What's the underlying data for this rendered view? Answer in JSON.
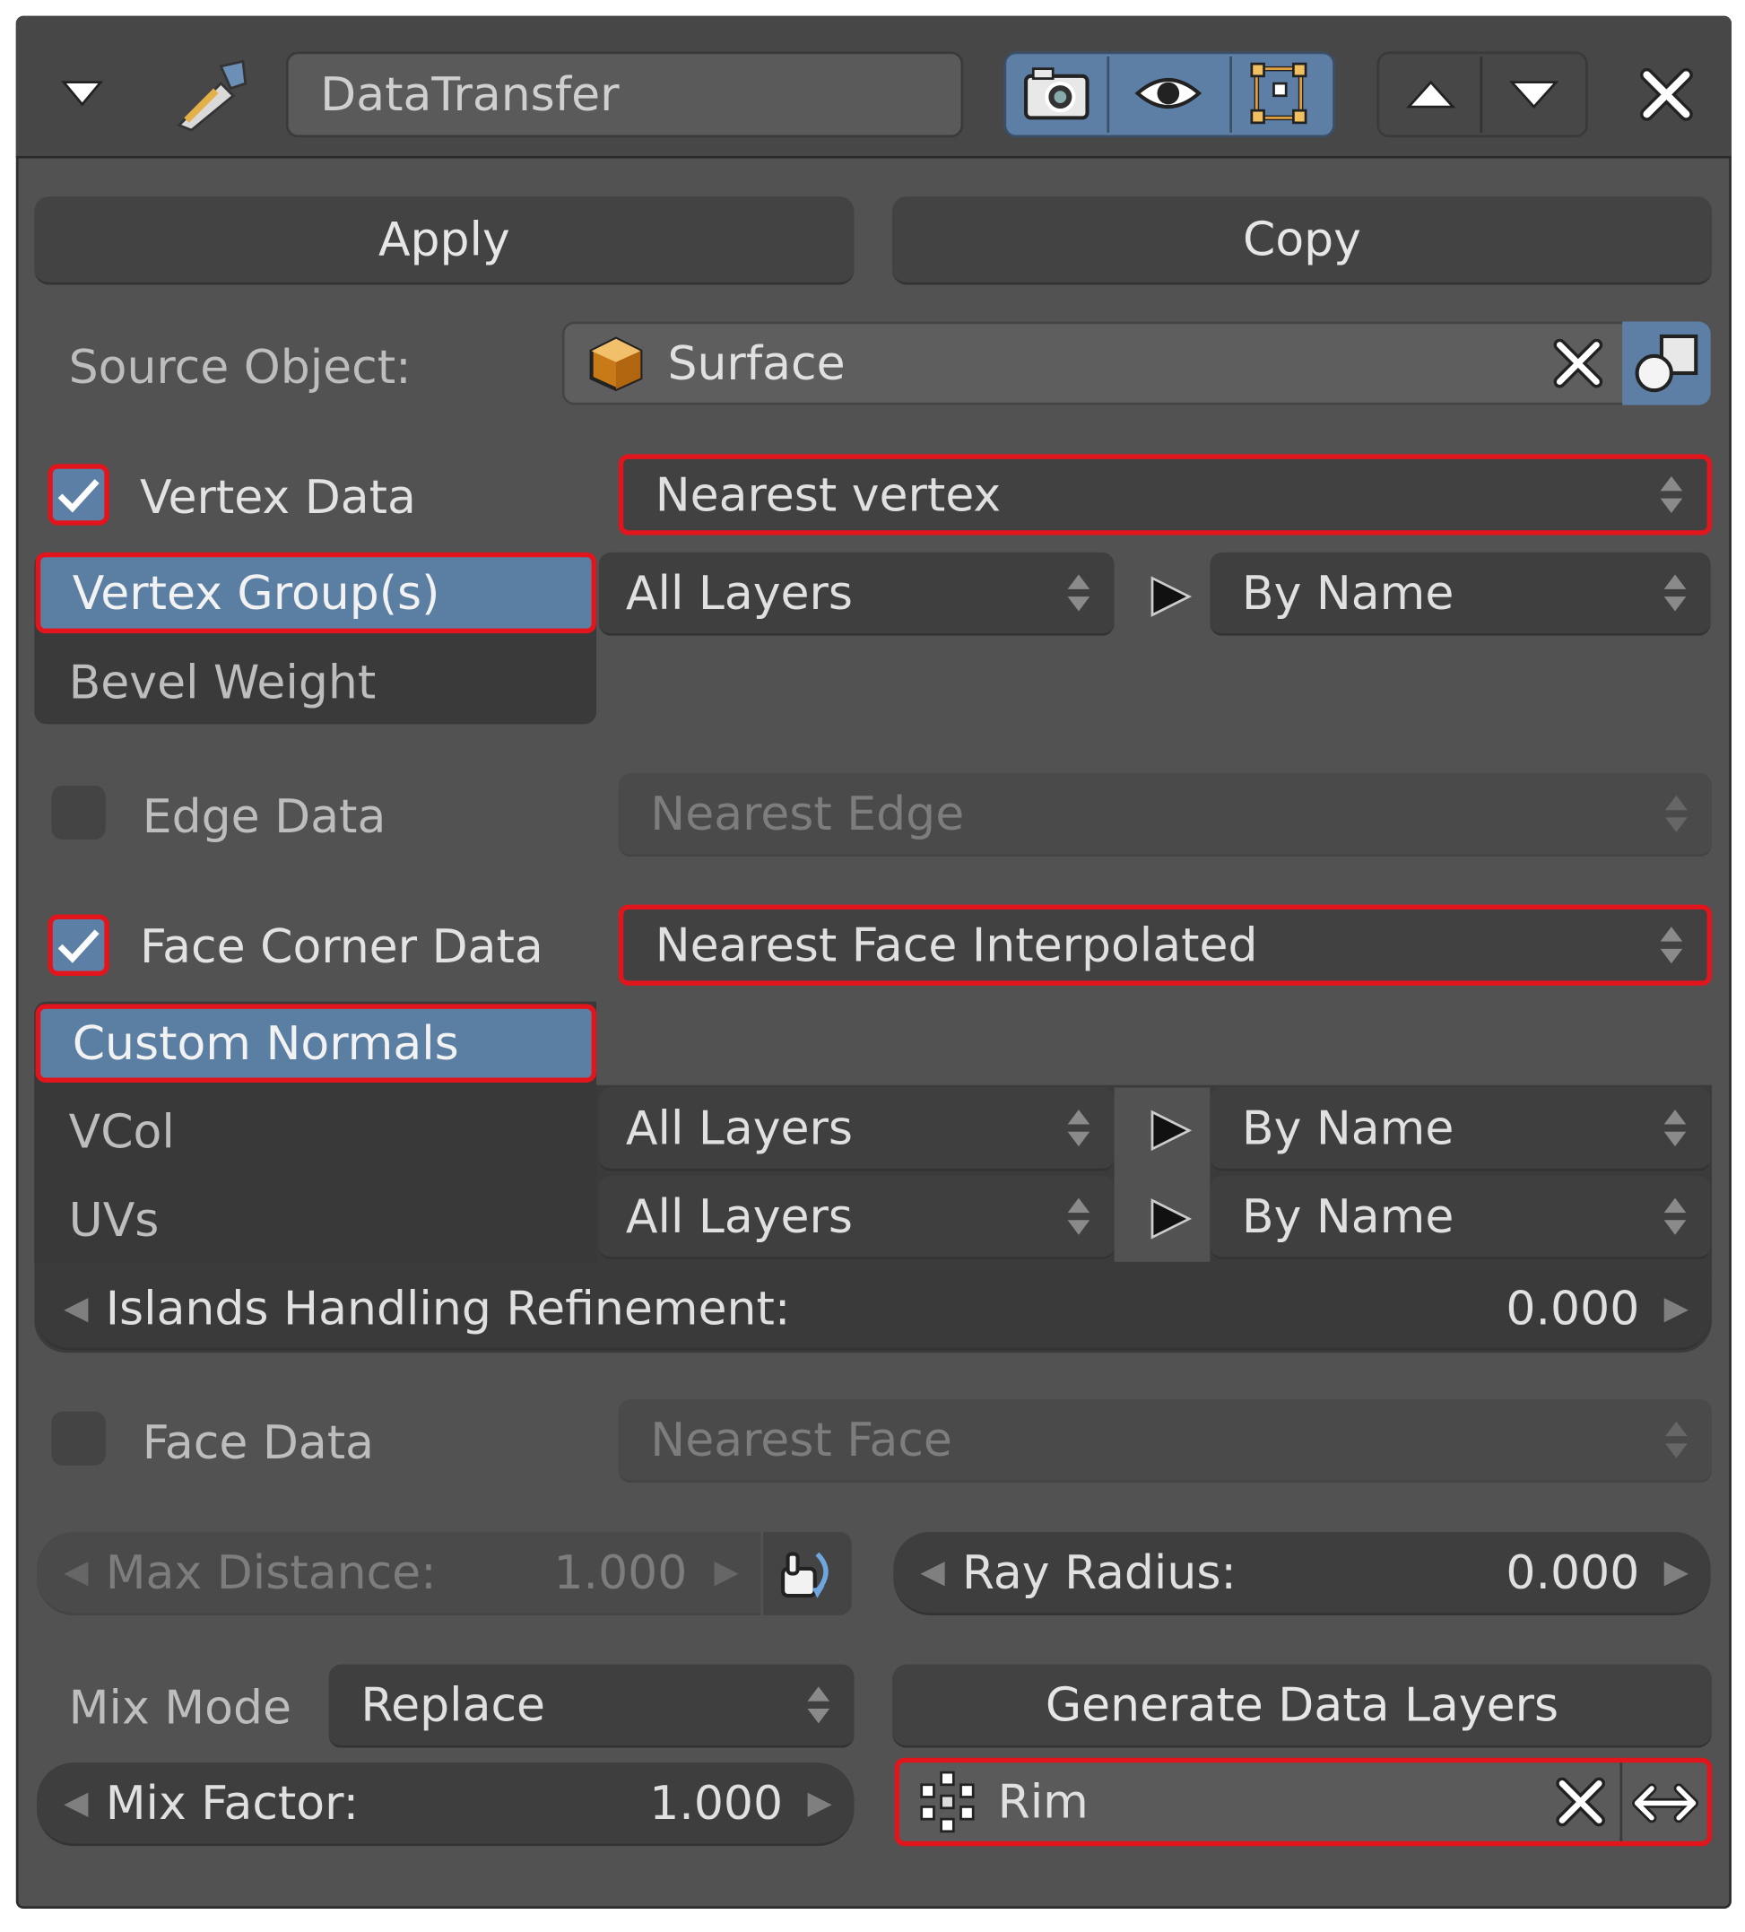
{
  "header": {
    "modifier_name": "DataTransfer",
    "icons": [
      "collapse-arrow-icon",
      "wrench-icon",
      "render-camera-icon",
      "eye-icon",
      "edit-mode-icon",
      "move-up-icon",
      "move-down-icon",
      "close-icon"
    ]
  },
  "actions": {
    "apply": "Apply",
    "copy": "Copy"
  },
  "source": {
    "label": "Source Object:",
    "value": "Surface"
  },
  "vertex": {
    "label": "Vertex Data",
    "checked": true,
    "mapping": "Nearest vertex",
    "types": [
      "Vertex Group(s)",
      "Bevel Weight"
    ],
    "layers_src": "All Layers",
    "layers_dst": "By Name"
  },
  "edge": {
    "label": "Edge Data",
    "checked": false,
    "mapping": "Nearest Edge"
  },
  "face_corner": {
    "label": "Face Corner Data",
    "checked": true,
    "mapping": "Nearest Face Interpolated",
    "rows": [
      {
        "type": "Custom Normals"
      },
      {
        "type": "VCol",
        "layers_src": "All Layers",
        "layers_dst": "By Name"
      },
      {
        "type": "UVs",
        "layers_src": "All Layers",
        "layers_dst": "By Name"
      }
    ],
    "islands_label": "Islands Handling Refinement:",
    "islands_value": "0.000"
  },
  "face": {
    "label": "Face Data",
    "checked": false,
    "mapping": "Nearest Face"
  },
  "distance": {
    "max_label": "Max Distance:",
    "max_value": "1.000",
    "ray_label": "Ray Radius:",
    "ray_value": "0.000"
  },
  "mix": {
    "mode_label": "Mix Mode",
    "mode_value": "Replace",
    "factor_label": "Mix Factor:",
    "factor_value": "1.000",
    "generate": "Generate Data Layers",
    "vgroup": "Rim"
  },
  "colors": {
    "panel": "#525252",
    "selected": "#5b7ea3",
    "highlight": "#e3151c"
  }
}
